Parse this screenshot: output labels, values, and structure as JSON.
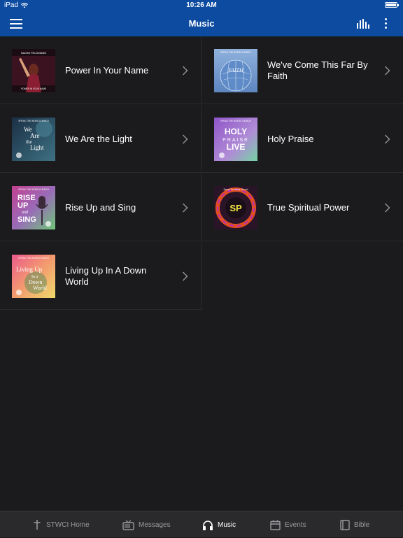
{
  "status_bar": {
    "device": "iPad",
    "time": "10:26 AM"
  },
  "header": {
    "title": "Music"
  },
  "albums": [
    {
      "title": "Power In Your Name",
      "art": {
        "top_text": "NAOMI FELDMANN",
        "bottom_text": "POWER IN YOUR NAME",
        "colors": [
          "#2a0f1a",
          "#7a1f35"
        ]
      }
    },
    {
      "title": "We've Come This Far By Faith",
      "art": {
        "top_text": "SPEAK THE WORD CHURCH",
        "main_text": "FAITH",
        "colors": [
          "#6f95c9",
          "#9bbbe0"
        ]
      }
    },
    {
      "title": "We Are the Light",
      "art": {
        "top_text": "SPEAK THE WORD CHURCH",
        "main_text": "We Are the Light",
        "colors": [
          "#1e3a52",
          "#3f6e82"
        ]
      }
    },
    {
      "title": "Holy Praise",
      "art": {
        "top_text": "SPEAK THE WORD CHURCH",
        "main_text": "HOLY PRAISE LIVE",
        "colors": [
          "#8a5bc2",
          "#7bd1a6"
        ]
      }
    },
    {
      "title": "Rise Up and Sing",
      "art": {
        "top_text": "SPEAK THE WORD CHURCH",
        "main_text": "RISE UP and SING",
        "colors": [
          "#c24a8e",
          "#6fc47a"
        ]
      }
    },
    {
      "title": "True Spiritual Power",
      "art": {
        "top_text": "Speak The Word Church",
        "main_text": "SP",
        "colors": [
          "#2a1530",
          "#e85a1a"
        ]
      }
    },
    {
      "title": "Living Up In A Down World",
      "art": {
        "top_text": "SPEAK THE WORD CHURCH",
        "main_text": "Living Up In a Down World",
        "colors": [
          "#e85a8a",
          "#f0d26a"
        ]
      }
    }
  ],
  "tabs": [
    {
      "label": "STWCI Home",
      "icon": "cross-icon",
      "active": false
    },
    {
      "label": "Messages",
      "icon": "tv-icon",
      "active": false
    },
    {
      "label": "Music",
      "icon": "headphones-icon",
      "active": true
    },
    {
      "label": "Events",
      "icon": "calendar-icon",
      "active": false
    },
    {
      "label": "Bible",
      "icon": "book-icon",
      "active": false
    }
  ],
  "colors": {
    "header": "#0c4ba0",
    "background": "#1b1b1d",
    "tabbar": "#2a2a2c",
    "tab_inactive": "#9a9a9e",
    "tab_active": "#ffffff"
  }
}
